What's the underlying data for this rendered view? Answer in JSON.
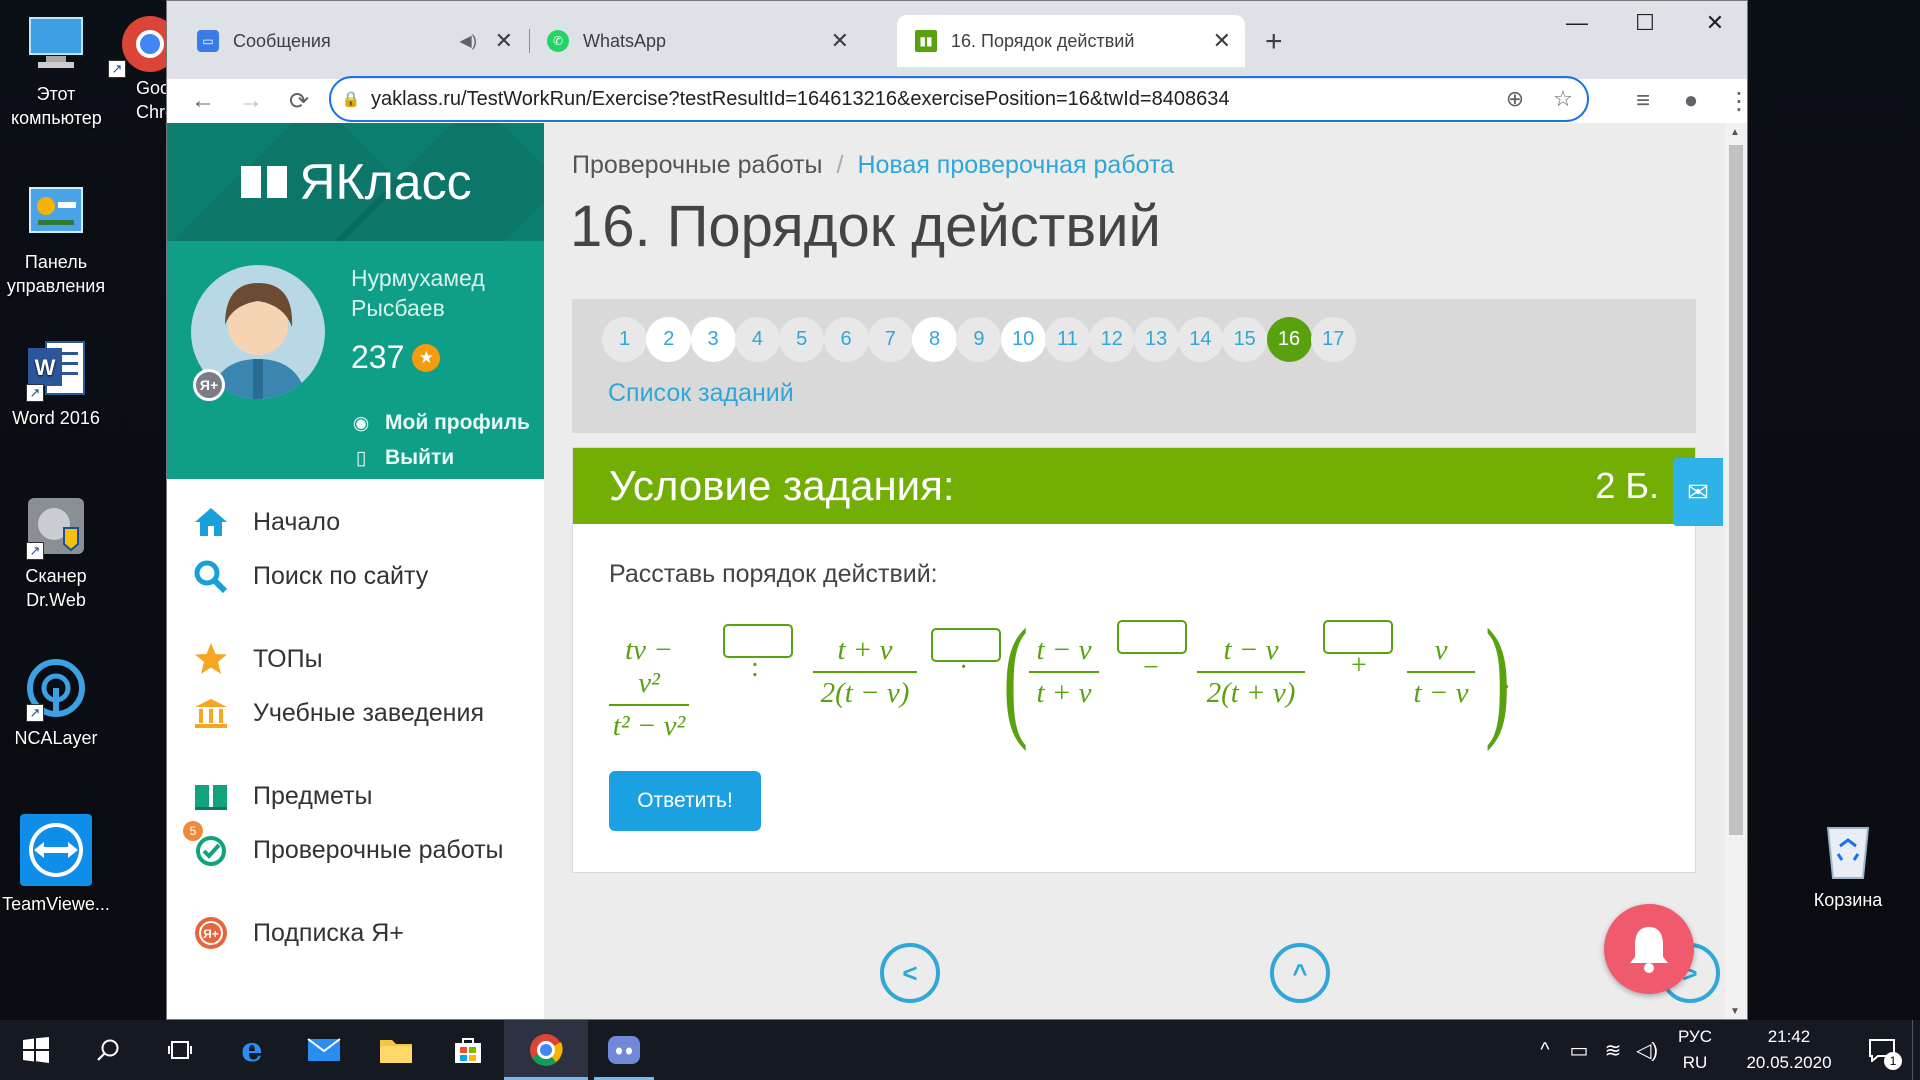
{
  "desktop": {
    "icons": [
      {
        "label": "Этот компьютер"
      },
      {
        "label": "Goo Chro"
      },
      {
        "label": "Панель управления"
      },
      {
        "label": "Word 2016"
      },
      {
        "label": "Сканер Dr.Web"
      },
      {
        "label": "NCALayer"
      },
      {
        "label": "TeamViewe..."
      },
      {
        "label": "Корзина"
      }
    ]
  },
  "browser": {
    "tabs": [
      {
        "title": "Сообщения",
        "favicon": "messages-icon"
      },
      {
        "title": "WhatsApp",
        "favicon": "whatsapp-icon"
      },
      {
        "title": "16. Порядок действий",
        "favicon": "yaklass-icon"
      }
    ],
    "url": "yaklass.ru/TestWorkRun/Exercise?testResultId=164613216&exercisePosition=16&twId=8408634"
  },
  "sidebar": {
    "logo": "ЯКласс",
    "user": {
      "first": "Нурмухамед",
      "last": "Рысбаев",
      "score": "237",
      "badge": "Я+",
      "profile": "Мой профиль",
      "logout": "Выйти"
    },
    "menu": [
      {
        "label": "Начало",
        "icon": "home-icon"
      },
      {
        "label": "Поиск по сайту",
        "icon": "search-icon"
      },
      {
        "label": "ТОПы",
        "icon": "star-icon"
      },
      {
        "label": "Учебные заведения",
        "icon": "building-icon"
      },
      {
        "label": "Предметы",
        "icon": "book-icon"
      },
      {
        "label": "Проверочные работы",
        "icon": "check-icon",
        "badge": "5"
      },
      {
        "label": "Подписка Я+",
        "icon": "yaplus-icon"
      }
    ]
  },
  "content": {
    "breadcrumb": [
      "Проверочные работы",
      "Новая проверочная работа"
    ],
    "breadcrumb_sep": "/",
    "title": "16. Порядок действий",
    "questions": [
      "1",
      "2",
      "3",
      "4",
      "5",
      "6",
      "7",
      "8",
      "9",
      "10",
      "11",
      "12",
      "13",
      "14",
      "15",
      "16",
      "17"
    ],
    "answered": [
      "2",
      "3",
      "8",
      "10"
    ],
    "current": "16",
    "task_list_link": "Список заданий",
    "task_header": "Условие задания:",
    "points": "2 Б.",
    "prompt": "Расставь порядок действий:",
    "expression": {
      "f1_num": "tv − v²",
      "f1_den": "t² − v²",
      "op1": ":",
      "f2_num": "t + v",
      "f2_den": "2(t − v)",
      "op2": "·",
      "f3_num": "t − v",
      "f3_den": "t + v",
      "op3": "−",
      "f4_num": "t − v",
      "f4_den": "2(t + v)",
      "op4": "+",
      "f5_num": "v",
      "f5_den": "t − v",
      "end": "."
    },
    "submit": "Ответить!"
  },
  "taskbar": {
    "lang1": "РУС",
    "lang2": "RU",
    "time": "21:42",
    "date": "20.05.2020",
    "notifications": "1"
  },
  "colors": {
    "accent_green": "#73ae05",
    "teal": "#0f9e87",
    "link": "#2fa7d8",
    "button": "#1ba0e2"
  }
}
